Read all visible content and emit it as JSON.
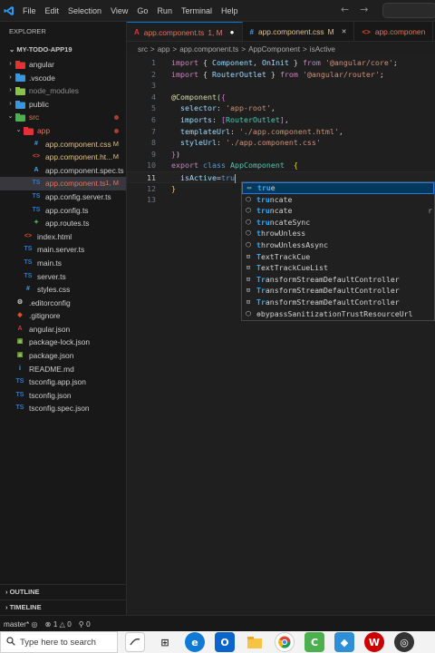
{
  "menubar": {
    "items": [
      "File",
      "Edit",
      "Selection",
      "View",
      "Go",
      "Run",
      "Terminal",
      "Help"
    ],
    "back_arrow": "←",
    "forward_arrow": "→"
  },
  "explorer": {
    "title": "EXPLORER",
    "project": "MY-TODO-APP19",
    "tree": [
      {
        "label": "angular",
        "prefix": ".",
        "icon": "folder-angular-icon",
        "chev": "›",
        "indent": 1,
        "color": "#cccccc"
      },
      {
        "label": ".vscode",
        "icon": "folder-vscode-icon",
        "chev": "›",
        "indent": 1,
        "color": "#cccccc"
      },
      {
        "label": "node_modules",
        "icon": "folder-node-icon",
        "chev": "›",
        "indent": 1,
        "color": "#8c8c8c"
      },
      {
        "label": "public",
        "icon": "folder-public-icon",
        "chev": "›",
        "indent": 1,
        "color": "#cccccc"
      },
      {
        "label": "src",
        "icon": "folder-src-icon",
        "chev": "⌄",
        "indent": 1,
        "color": "#e2735f",
        "dot": true
      },
      {
        "label": "app",
        "icon": "folder-app-icon",
        "chev": "⌄",
        "indent": 2,
        "color": "#e2735f",
        "dot": true
      },
      {
        "label": "app.component.css",
        "icon": "css-file-icon",
        "indent": 3,
        "color": "#e2c08d",
        "badge": "M"
      },
      {
        "label": "app.component.ht...",
        "icon": "html-file-icon",
        "indent": 3,
        "color": "#e2c08d",
        "badge": "M"
      },
      {
        "label": "app.component.spec.ts",
        "icon": "spec-file-icon",
        "indent": 3,
        "color": "#cccccc"
      },
      {
        "label": "app.component.ts",
        "icon": "ts-file-icon",
        "indent": 3,
        "color": "#e2735f",
        "badge": "1, M",
        "selected": true
      },
      {
        "label": "app.config.server.ts",
        "icon": "ts-file-icon",
        "indent": 3,
        "color": "#cccccc"
      },
      {
        "label": "app.config.ts",
        "icon": "ts-file-icon",
        "indent": 3,
        "color": "#cccccc"
      },
      {
        "label": "app.routes.ts",
        "icon": "routes-file-icon",
        "indent": 3,
        "color": "#cccccc"
      },
      {
        "label": "index.html",
        "icon": "html-file-icon",
        "indent": 2,
        "color": "#cccccc"
      },
      {
        "label": "main.server.ts",
        "icon": "ts-file-icon",
        "indent": 2,
        "color": "#cccccc"
      },
      {
        "label": "main.ts",
        "icon": "ts-file-icon",
        "indent": 2,
        "color": "#cccccc"
      },
      {
        "label": "server.ts",
        "icon": "ts-file-icon",
        "indent": 2,
        "color": "#cccccc"
      },
      {
        "label": "styles.css",
        "icon": "css-file-icon",
        "indent": 2,
        "color": "#cccccc"
      },
      {
        "label": ".editorconfig",
        "icon": "gear-icon",
        "indent": 1,
        "color": "#cccccc"
      },
      {
        "label": ".gitignore",
        "icon": "git-icon",
        "indent": 1,
        "color": "#cccccc"
      },
      {
        "label": "angular.json",
        "icon": "angular-icon",
        "indent": 1,
        "color": "#cccccc"
      },
      {
        "label": "package-lock.json",
        "icon": "npm-icon",
        "indent": 1,
        "color": "#cccccc"
      },
      {
        "label": "package.json",
        "icon": "npm-icon",
        "indent": 1,
        "color": "#cccccc"
      },
      {
        "label": "README.md",
        "icon": "info-icon",
        "indent": 1,
        "color": "#cccccc"
      },
      {
        "label": "tsconfig.app.json",
        "icon": "tsconfig-icon",
        "indent": 1,
        "color": "#cccccc"
      },
      {
        "label": "tsconfig.json",
        "icon": "tsconfig-icon",
        "indent": 1,
        "color": "#cccccc"
      },
      {
        "label": "tsconfig.spec.json",
        "icon": "tsconfig-icon",
        "indent": 1,
        "color": "#cccccc"
      }
    ],
    "outline": "OUTLINE",
    "timeline": "TIMELINE"
  },
  "tabs": [
    {
      "label": "app.component.ts",
      "badge": "1, M",
      "active": true,
      "icon": "angular-icon"
    },
    {
      "label": "app.component.css",
      "badge": "M",
      "active": false,
      "icon": "css-file-icon"
    },
    {
      "label": "app.componen",
      "badge": "",
      "active": false,
      "icon": "html-file-icon"
    }
  ],
  "breadcrumb": [
    "src",
    ">",
    "app",
    ">",
    "app.component.ts",
    ">",
    "AppComponent",
    ">",
    "isActive"
  ],
  "code_lines": [
    {
      "n": "1",
      "tokens": [
        [
          "import",
          "k-purple"
        ],
        [
          " { ",
          "k-punc"
        ],
        [
          "Component",
          "k-var"
        ],
        [
          ", ",
          "k-punc"
        ],
        [
          "OnInit",
          "k-var"
        ],
        [
          " } ",
          "k-punc"
        ],
        [
          "from",
          "k-purple"
        ],
        [
          " ",
          "k-punc"
        ],
        [
          "'@angular/core'",
          "k-str"
        ],
        [
          ";",
          "k-punc"
        ]
      ]
    },
    {
      "n": "2",
      "tokens": [
        [
          "import",
          "k-purple"
        ],
        [
          " { ",
          "k-punc"
        ],
        [
          "RouterOutlet",
          "k-var"
        ],
        [
          " } ",
          "k-punc"
        ],
        [
          "from",
          "k-purple"
        ],
        [
          " ",
          "k-punc"
        ],
        [
          "'@angular/router'",
          "k-str"
        ],
        [
          ";",
          "k-punc"
        ]
      ]
    },
    {
      "n": "3",
      "tokens": []
    },
    {
      "n": "4",
      "tokens": [
        [
          "@",
          "k-yellow"
        ],
        [
          "Component",
          "k-yellow"
        ],
        [
          "(",
          "k-punc"
        ],
        [
          "{",
          "k-brace"
        ]
      ]
    },
    {
      "n": "5",
      "tokens": [
        [
          "  selector",
          "k-var"
        ],
        [
          ": ",
          "k-punc"
        ],
        [
          "'app-root'",
          "k-str"
        ],
        [
          ",",
          "k-punc"
        ]
      ]
    },
    {
      "n": "6",
      "tokens": [
        [
          "  imports",
          "k-var"
        ],
        [
          ": ",
          "k-punc"
        ],
        [
          "[",
          "k-brace"
        ],
        [
          "RouterOutlet",
          "k-cyan"
        ],
        [
          "]",
          "k-brace"
        ],
        [
          ",",
          "k-punc"
        ]
      ]
    },
    {
      "n": "7",
      "tokens": [
        [
          "  templateUrl",
          "k-var"
        ],
        [
          ": ",
          "k-punc"
        ],
        [
          "'./app.component.html'",
          "k-str"
        ],
        [
          ",",
          "k-punc"
        ]
      ]
    },
    {
      "n": "8",
      "tokens": [
        [
          "  styleUrl",
          "k-var"
        ],
        [
          ": ",
          "k-punc"
        ],
        [
          "'./app.component.css'",
          "k-str"
        ]
      ]
    },
    {
      "n": "9",
      "tokens": [
        [
          "}",
          "k-brace"
        ],
        [
          ")",
          "k-punc"
        ]
      ]
    },
    {
      "n": "10",
      "tokens": [
        [
          "export",
          "k-purple"
        ],
        [
          " ",
          "k-punc"
        ],
        [
          "class",
          "k-blue"
        ],
        [
          " ",
          "k-punc"
        ],
        [
          "AppComponent",
          "k-cyan"
        ],
        [
          "  ",
          "k-punc"
        ],
        [
          "{",
          "k-gold"
        ]
      ]
    },
    {
      "n": "11",
      "tokens": [
        [
          "  isActive",
          "k-var"
        ],
        [
          "=",
          "k-punc"
        ],
        [
          "tru",
          "k-blue"
        ]
      ],
      "current": true
    },
    {
      "n": "12",
      "tokens": [
        [
          "}",
          "k-gold"
        ]
      ]
    },
    {
      "n": "13",
      "tokens": []
    }
  ],
  "suggestions": [
    {
      "label": "true",
      "match": "tru",
      "icon": "keyword-icon",
      "selected": true
    },
    {
      "label": "truncate",
      "match": "tru",
      "icon": "method-icon",
      "right": ""
    },
    {
      "label": "truncate",
      "match": "tru",
      "icon": "method-icon",
      "right": "r"
    },
    {
      "label": "truncateSync",
      "match": "tru",
      "icon": "method-icon",
      "right": ""
    },
    {
      "label": "throwUnless",
      "match": "t",
      "icon": "method-icon",
      "right": ""
    },
    {
      "label": "throwUnlessAsync",
      "match": "t",
      "icon": "method-icon",
      "right": ""
    },
    {
      "label": "TextTrackCue",
      "match": "T",
      "icon": "class-icon",
      "right": ""
    },
    {
      "label": "TextTrackCueList",
      "match": "T",
      "icon": "class-icon",
      "right": ""
    },
    {
      "label": "TransformStreamDefaultController",
      "match": "Tr",
      "icon": "class-icon",
      "right": ""
    },
    {
      "label": "TransformStreamDefaultController",
      "match": "Tr",
      "icon": "class-icon",
      "right": ""
    },
    {
      "label": "TransformStreamDefaultController",
      "match": "Tr",
      "icon": "class-icon",
      "right": ""
    },
    {
      "label": "ɵbypassSanitizationTrustResourceUrl",
      "match": "",
      "icon": "method-icon",
      "right": ""
    }
  ],
  "statusbar": {
    "branch": "master*",
    "errors": "1",
    "warnings": "0",
    "info": "0"
  },
  "taskbar": {
    "search_placeholder": "Type here to search"
  },
  "colors": {
    "accent": "#0078d4",
    "modified": "#e2c08d",
    "error": "#e2735f"
  }
}
